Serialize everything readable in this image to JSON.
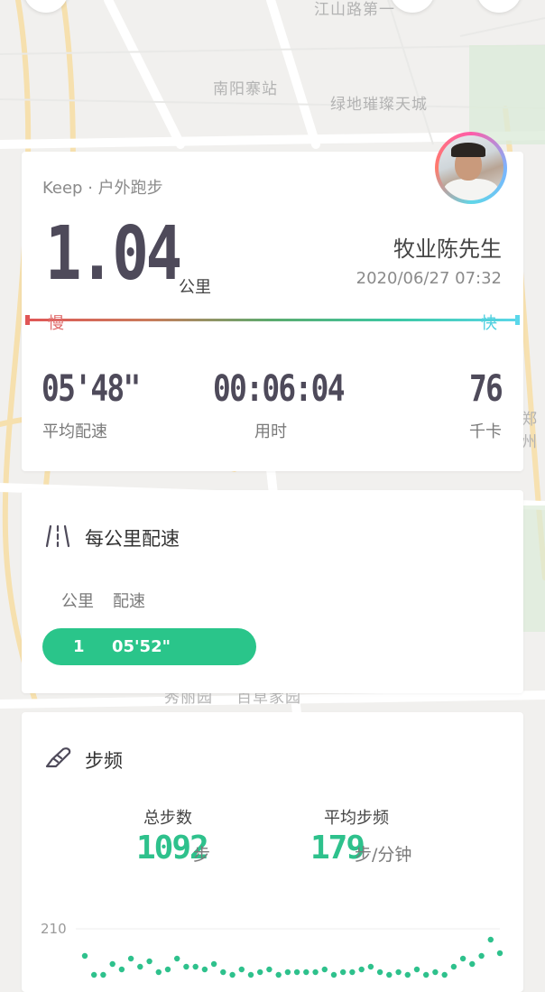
{
  "map": {
    "labels": [
      "江山路第一",
      "南阳寨站",
      "绿地璀璨天城",
      "郑州",
      "秀丽园",
      "百草家园"
    ]
  },
  "summary": {
    "app_label": "Keep · 户外跑步",
    "distance": "1.04",
    "distance_unit": "公里",
    "username": "牧业陈先生",
    "datetime": "2020/06/27 07:32",
    "slow_label": "慢",
    "fast_label": "快",
    "stats": [
      {
        "value": "05'48\"",
        "label": "平均配速"
      },
      {
        "value": "00:06:04",
        "label": "用时"
      },
      {
        "value": "76",
        "label": "千卡"
      }
    ]
  },
  "splits": {
    "title": "每公里配速",
    "col_km": "公里",
    "col_pace": "配速",
    "rows": [
      {
        "km": "1",
        "pace": "05'52\"",
        "fraction": 1.0
      }
    ]
  },
  "cadence": {
    "title": "步频",
    "total_steps_label": "总步数",
    "total_steps_value": "1092",
    "total_steps_unit": "步",
    "avg_cadence_label": "平均步频",
    "avg_cadence_value": "179",
    "avg_cadence_unit": "步/分钟"
  },
  "chart_data": {
    "type": "scatter",
    "yticks": [
      "210"
    ],
    "ylim": [
      170,
      210
    ],
    "x": [
      1,
      2,
      3,
      4,
      5,
      6,
      7,
      8,
      9,
      10,
      11,
      12,
      13,
      14,
      15,
      16,
      17,
      18,
      19,
      20,
      21,
      22,
      23,
      24,
      25,
      26,
      27,
      28,
      29,
      30,
      31,
      32,
      33,
      34,
      35,
      36,
      37,
      38,
      39,
      40,
      41,
      42,
      43,
      44,
      45,
      46
    ],
    "values": [
      200,
      193,
      193,
      197,
      195,
      199,
      196,
      198,
      194,
      195,
      199,
      196,
      196,
      195,
      197,
      194,
      193,
      195,
      193,
      194,
      195,
      193,
      194,
      194,
      194,
      194,
      195,
      193,
      194,
      194,
      195,
      196,
      194,
      193,
      194,
      193,
      195,
      193,
      194,
      193,
      196,
      199,
      197,
      200,
      206,
      201
    ],
    "color": "#2ec18c"
  },
  "colors": {
    "accent_green": "#2ec18c",
    "split_bar": "#2ac58a",
    "slow": "#e05656",
    "fast": "#5bd7ea",
    "digits": "#4e4a5a"
  }
}
